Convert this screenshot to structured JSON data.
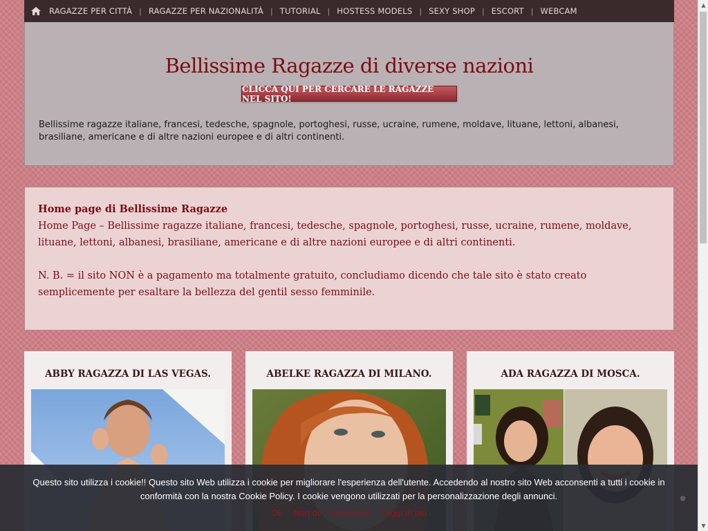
{
  "nav": {
    "items": [
      {
        "label": "RAGAZZE PER CITTÀ"
      },
      {
        "label": "RAGAZZE PER NAZIONALITÀ"
      },
      {
        "label": "TUTORIAL"
      },
      {
        "label": "HOSTESS MODELS"
      },
      {
        "label": "SEXY SHOP"
      },
      {
        "label": "ESCORT"
      },
      {
        "label": "WEBCAM"
      }
    ],
    "separator": "|"
  },
  "header": {
    "title": "Bellissime Ragazze di diverse nazioni",
    "cta_label": "CLICCA QUI PER CERCARE LE RAGAZZE NEL SITO!",
    "description": "Bellissime ragazze italiane, francesi, tedesche, spagnole, portoghesi, russe, ucraine, rumene, moldave, lituane, lettoni, albanesi, brasiliane, americane e di altre nazioni europee e di altri continenti."
  },
  "intro": {
    "heading": "Home page di Bellissime Ragazze",
    "paragraph1": "Home Page – Bellissime ragazze italiane, francesi,  tedesche, spagnole, portoghesi, russe, ucraine, rumene, moldave,  lituane, lettoni, albanesi, brasiliane, americane e di altre nazioni europee e di altri continenti.",
    "paragraph2": "N. B. = il sito NON è a pagamento ma totalmente gratuito, concludiamo dicendo che tale sito è stato creato semplicemente per esaltare la bellezza del gentil sesso femminile."
  },
  "cards": [
    {
      "title": "ABBY RAGAZZA DI LAS VEGAS."
    },
    {
      "title": "ABELKE RAGAZZA DI MILANO."
    },
    {
      "title": "ADA RAGAZZA DI MOSCA."
    }
  ],
  "cookie": {
    "text": "Questo sito utilizza i cookie!! Questo sito Web utilizza i cookie per migliorare l'esperienza dell'utente. Accedendo al nostro sito Web acconsenti a tutti i cookie in conformità con la nostra Cookie Policy. I cookie vengono utilizzati per la personalizzazione degli annunci.",
    "ok_label": "Ok",
    "decline_label": "Non do il consenso",
    "more_label": "Leggi di più",
    "close_label": "●"
  },
  "colors": {
    "nav_bg": "#3b2a2c",
    "title": "#7a0d12",
    "page_bg": "#cc7f86",
    "cookie_link": "#8a1a1a"
  }
}
